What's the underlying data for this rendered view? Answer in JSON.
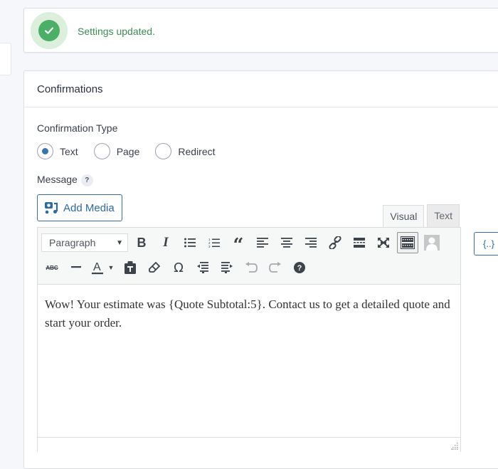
{
  "notice": {
    "message": "Settings updated.",
    "icon": "check-circle-icon",
    "color": "#4caf67"
  },
  "panel": {
    "title": "Confirmations",
    "confirmation_type": {
      "label": "Confirmation Type",
      "options": [
        {
          "label": "Text",
          "selected": true
        },
        {
          "label": "Page",
          "selected": false
        },
        {
          "label": "Redirect",
          "selected": false
        }
      ]
    },
    "message": {
      "label": "Message",
      "help": "?"
    }
  },
  "editor": {
    "add_media_label": "Add Media",
    "tabs": [
      {
        "label": "Visual",
        "active": true
      },
      {
        "label": "Text",
        "active": false
      }
    ],
    "format_select": "Paragraph",
    "toolbar_row1": [
      "bold-icon",
      "italic-icon",
      "bullet-list-icon",
      "numbered-list-icon",
      "blockquote-icon",
      "align-left-icon",
      "align-center-icon",
      "align-right-icon",
      "link-icon",
      "read-more-icon",
      "fullscreen-icon",
      "toolbar-toggle-icon",
      "user-avatar-icon"
    ],
    "toolbar_row2": [
      "strikethrough-icon",
      "horizontal-line-icon",
      "text-color-icon",
      "paste-text-icon",
      "clear-formatting-icon",
      "special-character-icon",
      "outdent-icon",
      "indent-icon",
      "undo-icon",
      "redo-icon",
      "help-icon"
    ],
    "content": "Wow! Your estimate was {Quote Subtotal:5}. Contact us to get a detailed quote and start your order.",
    "merge_tag_label": "{..}"
  },
  "colors": {
    "accent": "#2f6a9b",
    "success": "#4caf67",
    "background": "#f6f7fb"
  }
}
